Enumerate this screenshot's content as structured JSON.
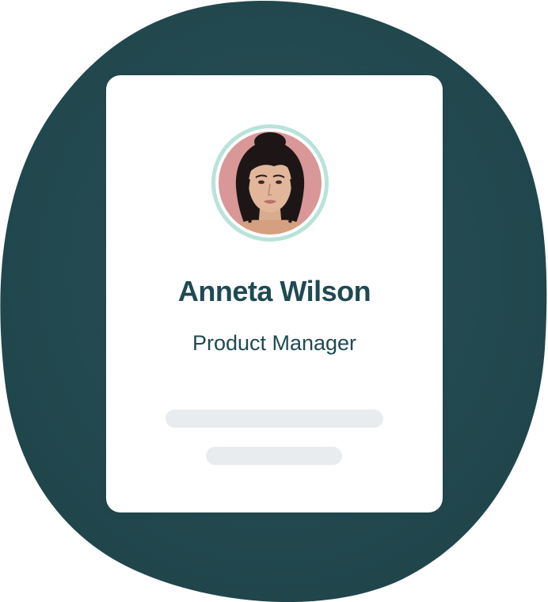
{
  "profile": {
    "name": "Anneta Wilson",
    "role": "Product Manager"
  },
  "colors": {
    "blob": "#23494f",
    "name_text": "#1f4a52",
    "avatar_ring": "#b9e3d9",
    "skeleton": "#e9ecee",
    "avatar_background": "#d99797"
  },
  "icons": {
    "avatar": "person-portrait-icon"
  }
}
